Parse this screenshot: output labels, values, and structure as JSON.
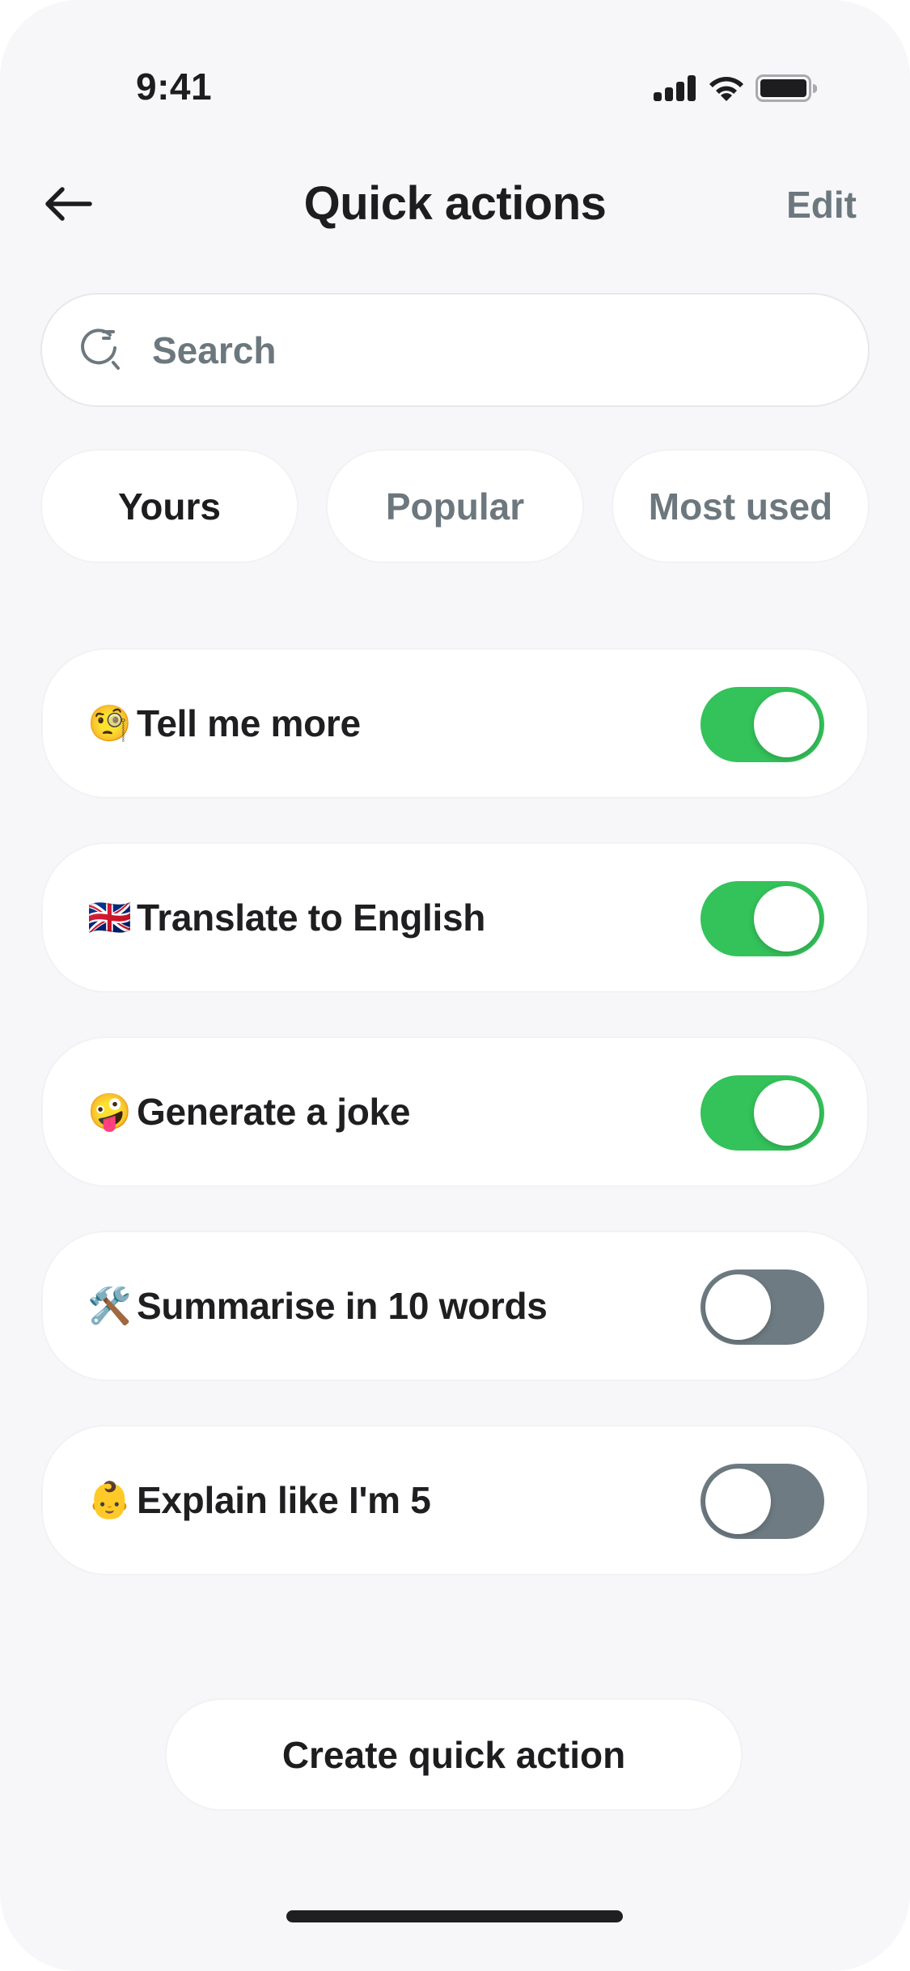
{
  "status_bar": {
    "time": "9:41",
    "icons": [
      "cellular-signal-icon",
      "wifi-icon",
      "battery-icon"
    ]
  },
  "header": {
    "back_icon": "arrow-left-icon",
    "title": "Quick actions",
    "edit_label": "Edit"
  },
  "search": {
    "icon": "search-icon",
    "placeholder": "Search",
    "value": ""
  },
  "tabs": [
    {
      "label": "Yours",
      "active": true
    },
    {
      "label": "Popular",
      "active": false
    },
    {
      "label": "Most used",
      "active": false
    }
  ],
  "actions": [
    {
      "emoji": "🧐",
      "emoji_name": "face-with-monocle-icon",
      "label": "Tell me more",
      "enabled": true
    },
    {
      "emoji": "🇬🇧",
      "emoji_name": "uk-flag-icon",
      "label": "Translate to English",
      "enabled": true
    },
    {
      "emoji": "🤪",
      "emoji_name": "zany-face-icon",
      "label": "Generate a joke",
      "enabled": true
    },
    {
      "emoji": "🛠️",
      "emoji_name": "hammer-and-wrench-icon",
      "label": "Summarise in 10 words",
      "enabled": false
    },
    {
      "emoji": "👶",
      "emoji_name": "baby-face-icon",
      "label": "Explain like I'm 5",
      "enabled": false
    }
  ],
  "create_button": {
    "label": "Create quick action"
  },
  "colors": {
    "background": "#F7F7F9",
    "card": "#FFFFFF",
    "text_primary": "#1D1D1F",
    "text_secondary": "#6C777E",
    "toggle_on": "#34C25A",
    "toggle_off": "#6E7B82"
  }
}
